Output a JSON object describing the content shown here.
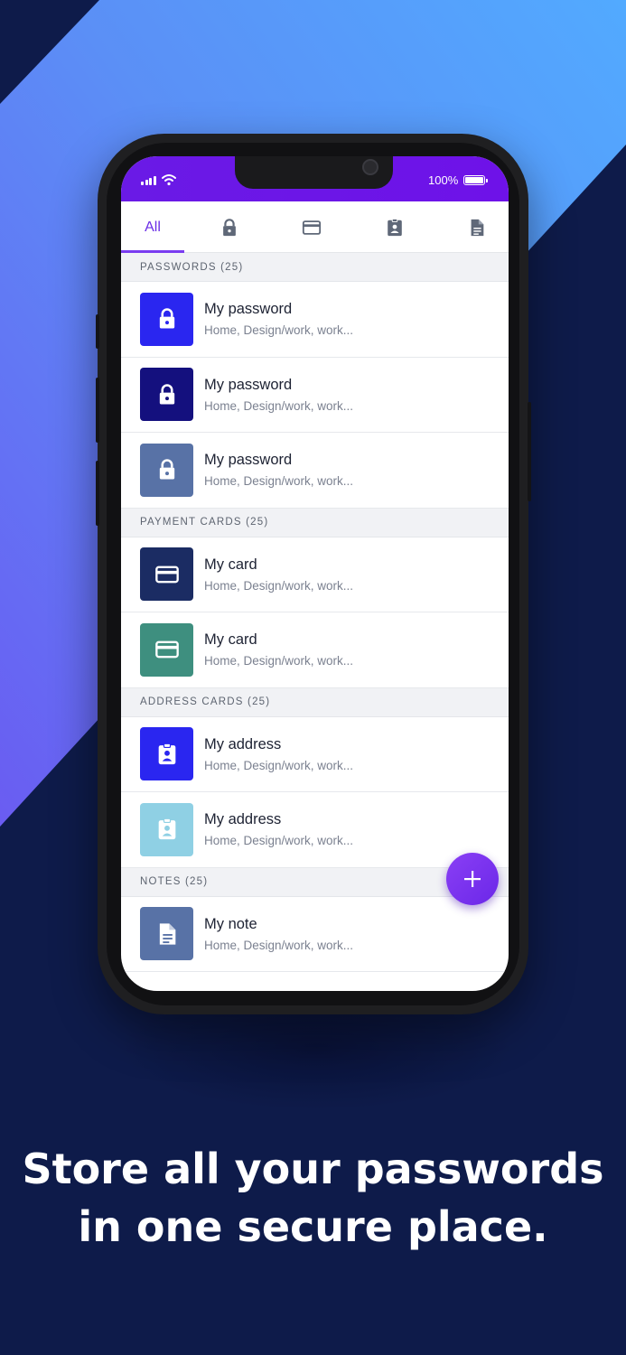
{
  "colors": {
    "background": "#0e1b4a",
    "accent": "#6b2ee6",
    "status_bar": "#6a1ae6",
    "fab": "#7b34ee"
  },
  "status_bar": {
    "battery_text": "100%"
  },
  "tabs": [
    {
      "label": "All",
      "selected": true
    },
    {
      "icon": "lock-icon"
    },
    {
      "icon": "credit-card-icon"
    },
    {
      "icon": "contact-card-icon"
    },
    {
      "icon": "document-icon"
    }
  ],
  "sections": [
    {
      "header": "PASSWORDS (25)",
      "items": [
        {
          "title": "My password",
          "subtitle": "Home, Design/work, work...",
          "icon": "lock-icon",
          "color": "#2a26f0"
        },
        {
          "title": "My password",
          "subtitle": "Home, Design/work, work...",
          "icon": "lock-icon",
          "color": "#14107e"
        },
        {
          "title": "My password",
          "subtitle": "Home, Design/work, work...",
          "icon": "lock-icon",
          "color": "#5872a6"
        }
      ]
    },
    {
      "header": "PAYMENT CARDS (25)",
      "items": [
        {
          "title": "My card",
          "subtitle": "Home, Design/work, work...",
          "icon": "credit-card-icon",
          "color": "#1b2c63"
        },
        {
          "title": "My card",
          "subtitle": "Home, Design/work, work...",
          "icon": "credit-card-icon",
          "color": "#3e8f7f"
        }
      ]
    },
    {
      "header": "ADDRESS CARDS (25)",
      "items": [
        {
          "title": "My address",
          "subtitle": "Home, Design/work, work...",
          "icon": "contact-card-icon",
          "color": "#2a26f0"
        },
        {
          "title": "My address",
          "subtitle": "Home, Design/work, work...",
          "icon": "contact-card-icon",
          "color": "#8fd0e4"
        }
      ]
    },
    {
      "header": "NOTES (25)",
      "items": [
        {
          "title": "My note",
          "subtitle": "Home, Design/work, work...",
          "icon": "document-icon",
          "color": "#5872a6"
        }
      ]
    }
  ],
  "fab": {
    "icon": "plus-icon"
  },
  "headline": {
    "line1": "Store all your passwords",
    "line2": "in one secure place."
  }
}
